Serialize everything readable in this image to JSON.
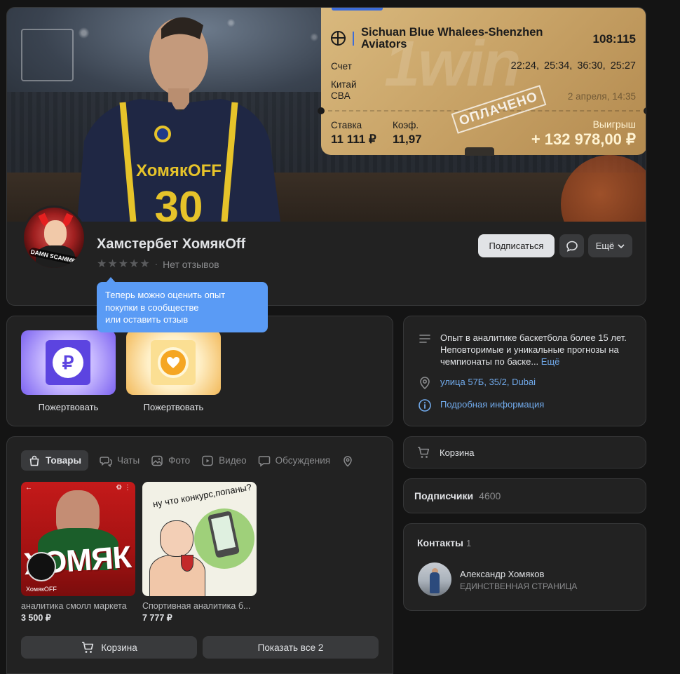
{
  "ticket": {
    "teams": "Sichuan Blue Whalees-Shenzhen Aviators",
    "score": "108:115",
    "schet_label": "Счет",
    "periods": "22:24, 25:34, 36:30, 25:27",
    "country": "Китай",
    "league": "CBA",
    "date": "2 апреля, 14:35",
    "stamp": "ОПЛАЧЕНО",
    "watermark": "1win",
    "stavka_label": "Ставка",
    "stavka_value": "11 111 ₽",
    "koef_label": "Коэф.",
    "koef_value": "11,97",
    "win_label": "Выигрыш",
    "win_value": "+ 132 978,00 ₽"
  },
  "cover": {
    "jersey_text": "ХомякOFF",
    "jersey_number": "30"
  },
  "profile": {
    "name": "Хамстербет ХомякOff",
    "rating_sep": "·",
    "no_reviews": "Нет отзывов",
    "avatar_tag": "DAMN SCAMMER",
    "subscribe_label": "Подписаться",
    "more_label": "Ещё"
  },
  "tooltip": {
    "line1": "Теперь можно оценить опыт",
    "line2": "покупки в сообществе",
    "line3": "или оставить отзыв"
  },
  "donate": {
    "items": [
      {
        "label": "Пожертвовать",
        "symbol": "₽"
      },
      {
        "label": "Пожертвовать",
        "symbol": "♥"
      }
    ]
  },
  "info": {
    "description": "Опыт в аналитике баскетбола более 15 лет. Неповторимые и уникальные прогнозы на чемпионаты по баске...",
    "more": "Ещё",
    "address": "улица 57Б, 35/2, Dubai",
    "details": "Подробная информация"
  },
  "cart_card": {
    "label": "Корзина"
  },
  "subscribers": {
    "label": "Подписчики",
    "count": "4600"
  },
  "contacts": {
    "title": "Контакты",
    "count": "1",
    "person_name": "Александр Хомяков",
    "person_role": "ЕДИНСТВЕННАЯ СТРАНИЦА"
  },
  "goods": {
    "tabs": [
      {
        "label": "Товары",
        "icon": "bag-icon",
        "active": true
      },
      {
        "label": "Чаты",
        "icon": "chats-icon"
      },
      {
        "label": "Фото",
        "icon": "photo-icon"
      },
      {
        "label": "Видео",
        "icon": "video-icon"
      },
      {
        "label": "Обсуждения",
        "icon": "discussion-icon"
      },
      {
        "label": "",
        "icon": "location-icon"
      }
    ],
    "products": [
      {
        "title": "аналитика смолл маркета",
        "price": "3 500 ₽",
        "image_text": "ХОМЯК",
        "image_caption": "ХомякOFF"
      },
      {
        "title": "Спортивная аналитика б...",
        "price": "7 777 ₽",
        "image_text": "ну что конкурс,попаны?"
      }
    ],
    "cart_button": "Корзина",
    "show_all_button": "Показать все 2"
  },
  "colors": {
    "background": "#141414",
    "card": "#222222",
    "link": "#71aaeb",
    "tooltip": "#5a9bf5",
    "ticket_gold": "#c9a468"
  }
}
